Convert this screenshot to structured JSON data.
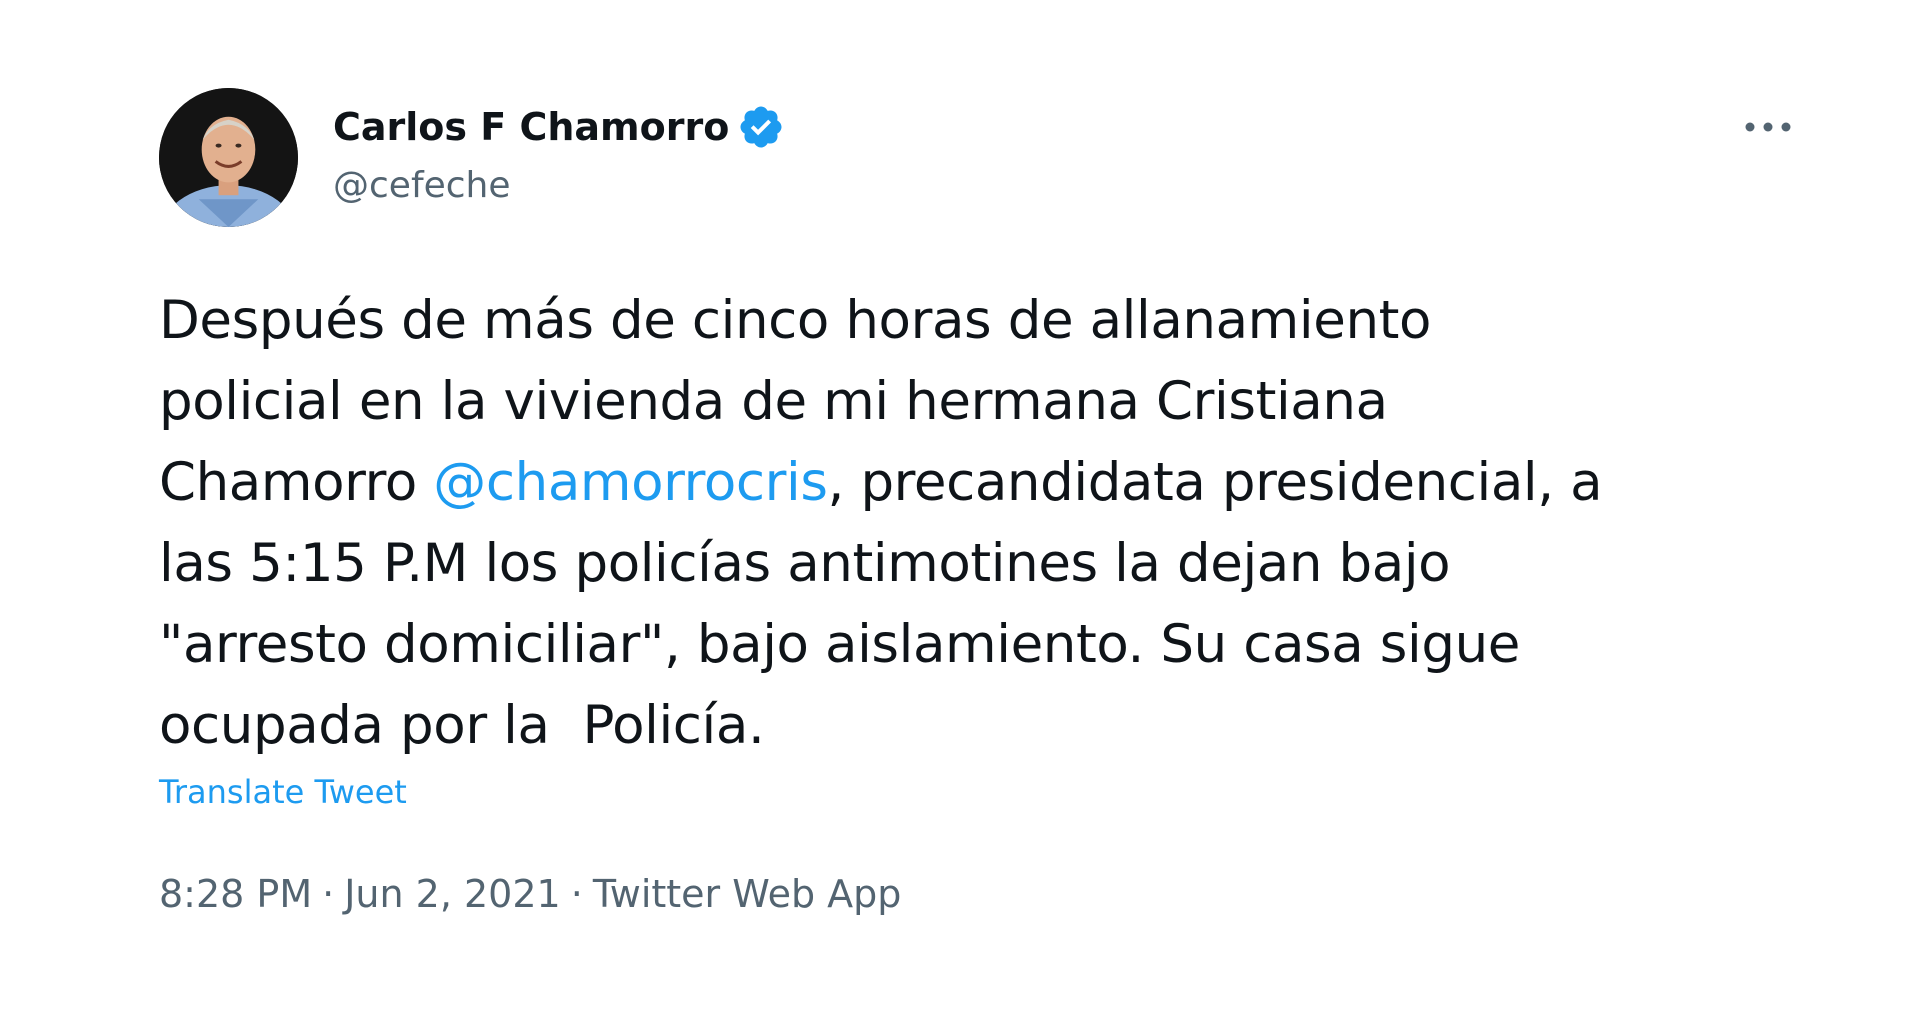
{
  "author": {
    "name": "Carlos F Chamorro",
    "handle": "@cefeche",
    "verified": true,
    "avatar_icon": "avatar-photo"
  },
  "menu": {
    "icon": "more-horizontal-icon"
  },
  "tweet": {
    "text_lines": [
      "Después de más de cinco horas de allanamiento",
      "policial en la vivienda de mi hermana Cristiana",
      "Chamorro ",
      ", precandidata presidencial, a",
      "las 5:15 P.M los policías antimotines la dejan bajo",
      "\"arresto domiciliar\", bajo aislamiento. Su casa sigue",
      "ocupada por la  Policía."
    ],
    "mention": "@chamorrocris",
    "translate_label": "Translate Tweet"
  },
  "meta": {
    "time": "8:28 PM",
    "separator": "·",
    "date": "Jun 2, 2021",
    "source": "Twitter Web App"
  },
  "colors": {
    "text": "#0f1419",
    "secondary": "#536471",
    "accent": "#1d9bf0"
  }
}
